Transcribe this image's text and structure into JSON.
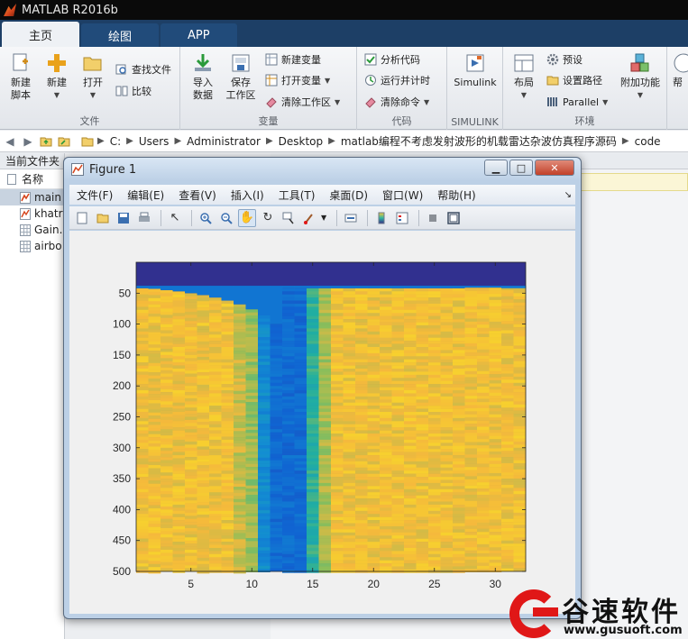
{
  "app": {
    "title": "MATLAB R2016b"
  },
  "tabs": [
    {
      "label": "主页",
      "active": true
    },
    {
      "label": "绘图",
      "active": false
    },
    {
      "label": "APP",
      "active": false
    }
  ],
  "ribbon": {
    "file": {
      "label": "文件",
      "new_script": "新建\n脚本",
      "new": "新建",
      "open": "打开",
      "find_files": "查找文件",
      "compare": "比较"
    },
    "variable": {
      "label": "变量",
      "import_data": "导入\n数据",
      "save_workspace": "保存\n工作区",
      "new_variable": "新建变量",
      "open_variable": "打开变量",
      "clear_workspace": "清除工作区"
    },
    "code": {
      "label": "代码",
      "analyze_code": "分析代码",
      "run_and_time": "运行并计时",
      "clear_commands": "清除命令"
    },
    "simulink": {
      "label": "SIMULINK",
      "simulink": "Simulink"
    },
    "environment": {
      "label": "环境",
      "layout": "布局",
      "preferences": "预设",
      "set_path": "设置路径",
      "parallel": "Parallel",
      "addons": "附加功能",
      "help": "帮"
    }
  },
  "address": {
    "crumbs": [
      "C:",
      "Users",
      "Administrator",
      "Desktop",
      "matlab编程不考虑发射波形的机载雷达杂波仿真程序源码",
      "code"
    ]
  },
  "current_folder": {
    "header": "当前文件夹",
    "col_name": "名称",
    "files": [
      {
        "name": "main",
        "selected": true
      },
      {
        "name": "khatri",
        "selected": false
      },
      {
        "name": "Gain.",
        "selected": false
      },
      {
        "name": "airbo",
        "selected": false
      }
    ]
  },
  "figure": {
    "title": "Figure 1",
    "menu": [
      "文件(F)",
      "编辑(E)",
      "查看(V)",
      "插入(I)",
      "工具(T)",
      "桌面(D)",
      "窗口(W)",
      "帮助(H)"
    ]
  },
  "watermark": {
    "name": "谷速软件",
    "url": "www.gusuoft.com"
  },
  "colors": {
    "tab_bg": "#1d3f66",
    "heat_dark": "#352a87",
    "heat_blue": "#1f6ed4",
    "heat_cyan": "#2fb5a0",
    "heat_yellow": "#f5c73c",
    "watermark_red": "#e01717"
  },
  "chart_data": {
    "type": "heatmap",
    "title": "",
    "xlabel": "",
    "ylabel": "",
    "xlim": [
      0.5,
      32.5
    ],
    "ylim": [
      0,
      500
    ],
    "y_reversed": true,
    "x_ticks": [
      5,
      10,
      15,
      20,
      25,
      30
    ],
    "y_ticks": [
      50,
      100,
      150,
      200,
      250,
      300,
      350,
      400,
      450,
      500
    ],
    "columns": 32,
    "rows": 500,
    "colormap": "parula",
    "clim": [
      0,
      1
    ],
    "dark_top_rows": 38,
    "regions": [
      {
        "cols": [
          1,
          8
        ],
        "level": 0.86,
        "note": "yellow clutter"
      },
      {
        "cols": [
          9,
          9
        ],
        "level": 0.78
      },
      {
        "cols": [
          10,
          10
        ],
        "level": 0.72
      },
      {
        "cols": [
          11,
          11
        ],
        "level": 0.38
      },
      {
        "cols": [
          12,
          14
        ],
        "level": 0.24,
        "note": "blue notch"
      },
      {
        "cols": [
          15,
          15
        ],
        "level": 0.56
      },
      {
        "cols": [
          16,
          16
        ],
        "level": 0.74
      },
      {
        "cols": [
          17,
          32
        ],
        "level": 0.86
      }
    ],
    "onset_rows": [
      42,
      43,
      45,
      47,
      50,
      53,
      57,
      62,
      68,
      76,
      86,
      100,
      42,
      42,
      42,
      42,
      42,
      42,
      42,
      42,
      42,
      42,
      42,
      42,
      42,
      42,
      42,
      41,
      41,
      41,
      40,
      40
    ]
  }
}
